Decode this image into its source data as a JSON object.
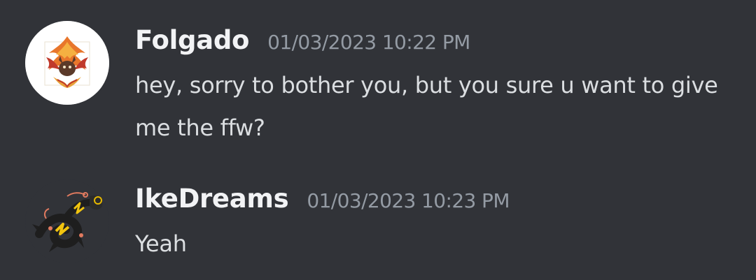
{
  "messages": [
    {
      "username": "Folgado",
      "timestamp": "01/03/2023 10:22 PM",
      "text": "hey, sorry to bother you, but you sure u want to give me the ffw?",
      "avatar_icon": "phoenix-crest-icon"
    },
    {
      "username": "IkeDreams",
      "timestamp": "01/03/2023 10:23 PM",
      "text": "Yeah",
      "avatar_icon": "shiny-rayquaza-icon"
    }
  ],
  "colors": {
    "background": "#313338",
    "username": "#f2f3f5",
    "timestamp": "#949ba4",
    "message_text": "#dbdee1"
  }
}
